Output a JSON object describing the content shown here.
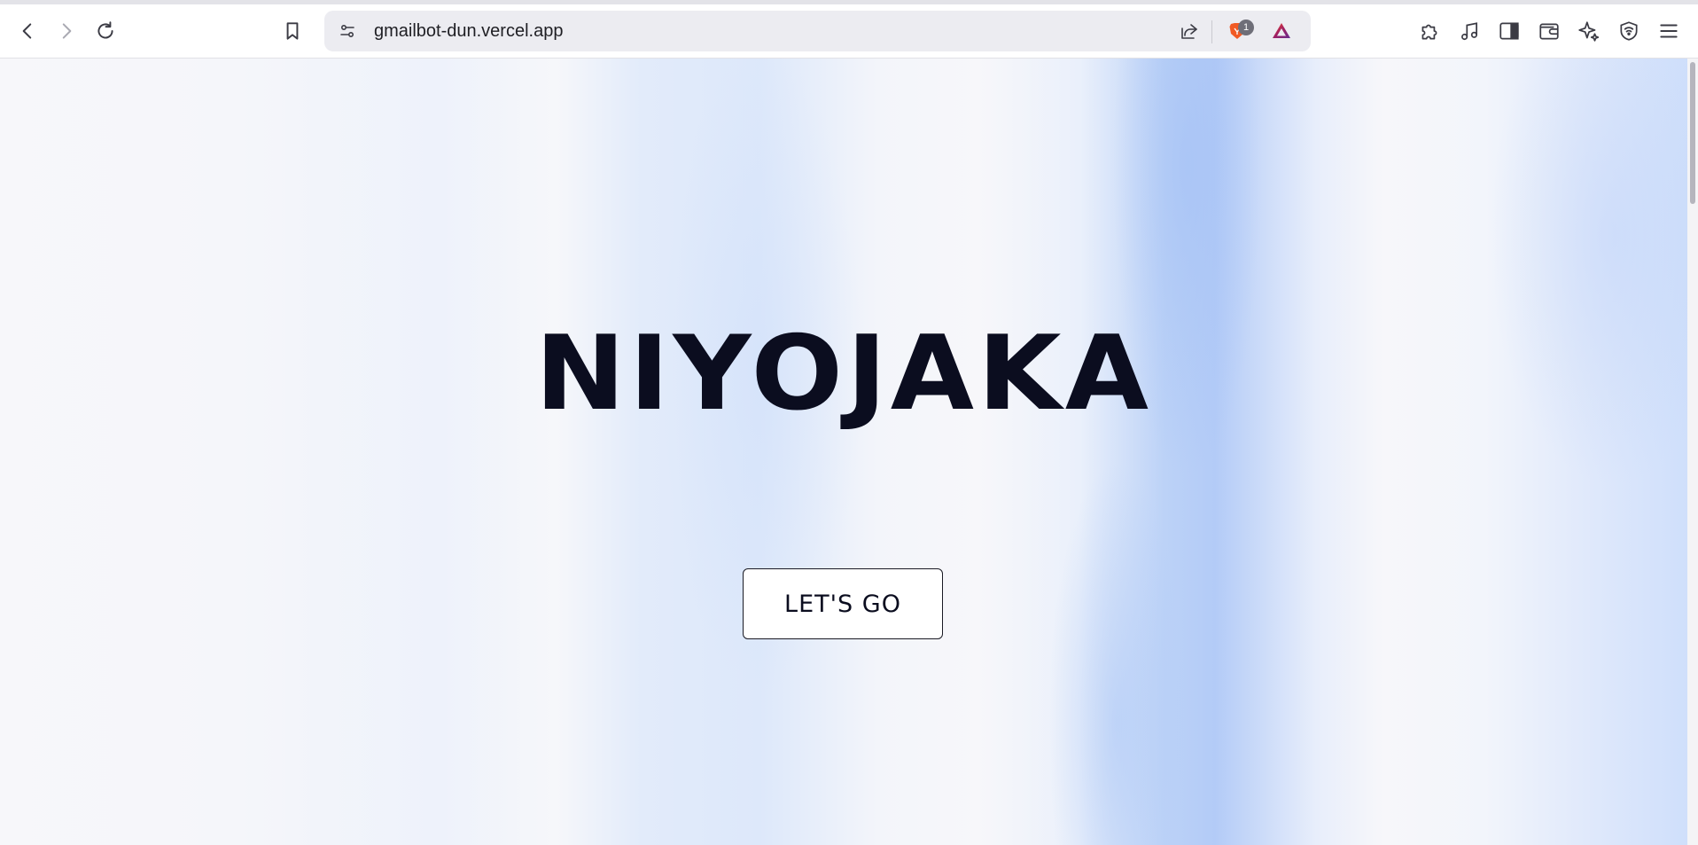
{
  "browser": {
    "url": "gmailbot-dun.vercel.app",
    "shields_badge_count": "1",
    "icons": {
      "back": "back-arrow-icon",
      "forward": "forward-arrow-icon",
      "reload": "reload-icon",
      "bookmark": "bookmark-icon",
      "site_settings": "site-settings-icon",
      "share": "share-icon",
      "brave_shields": "brave-lion-icon",
      "brave_rewards": "brave-rewards-triangle-icon",
      "extensions": "puzzle-icon",
      "media": "music-note-icon",
      "sidebar": "sidebar-icon",
      "wallet": "wallet-icon",
      "leo": "sparkle-icon",
      "vpn": "shield-wifi-icon",
      "menu": "hamburger-menu-icon"
    }
  },
  "hero": {
    "title": "NIYOJAKA",
    "cta_label": "LET'S GO"
  }
}
